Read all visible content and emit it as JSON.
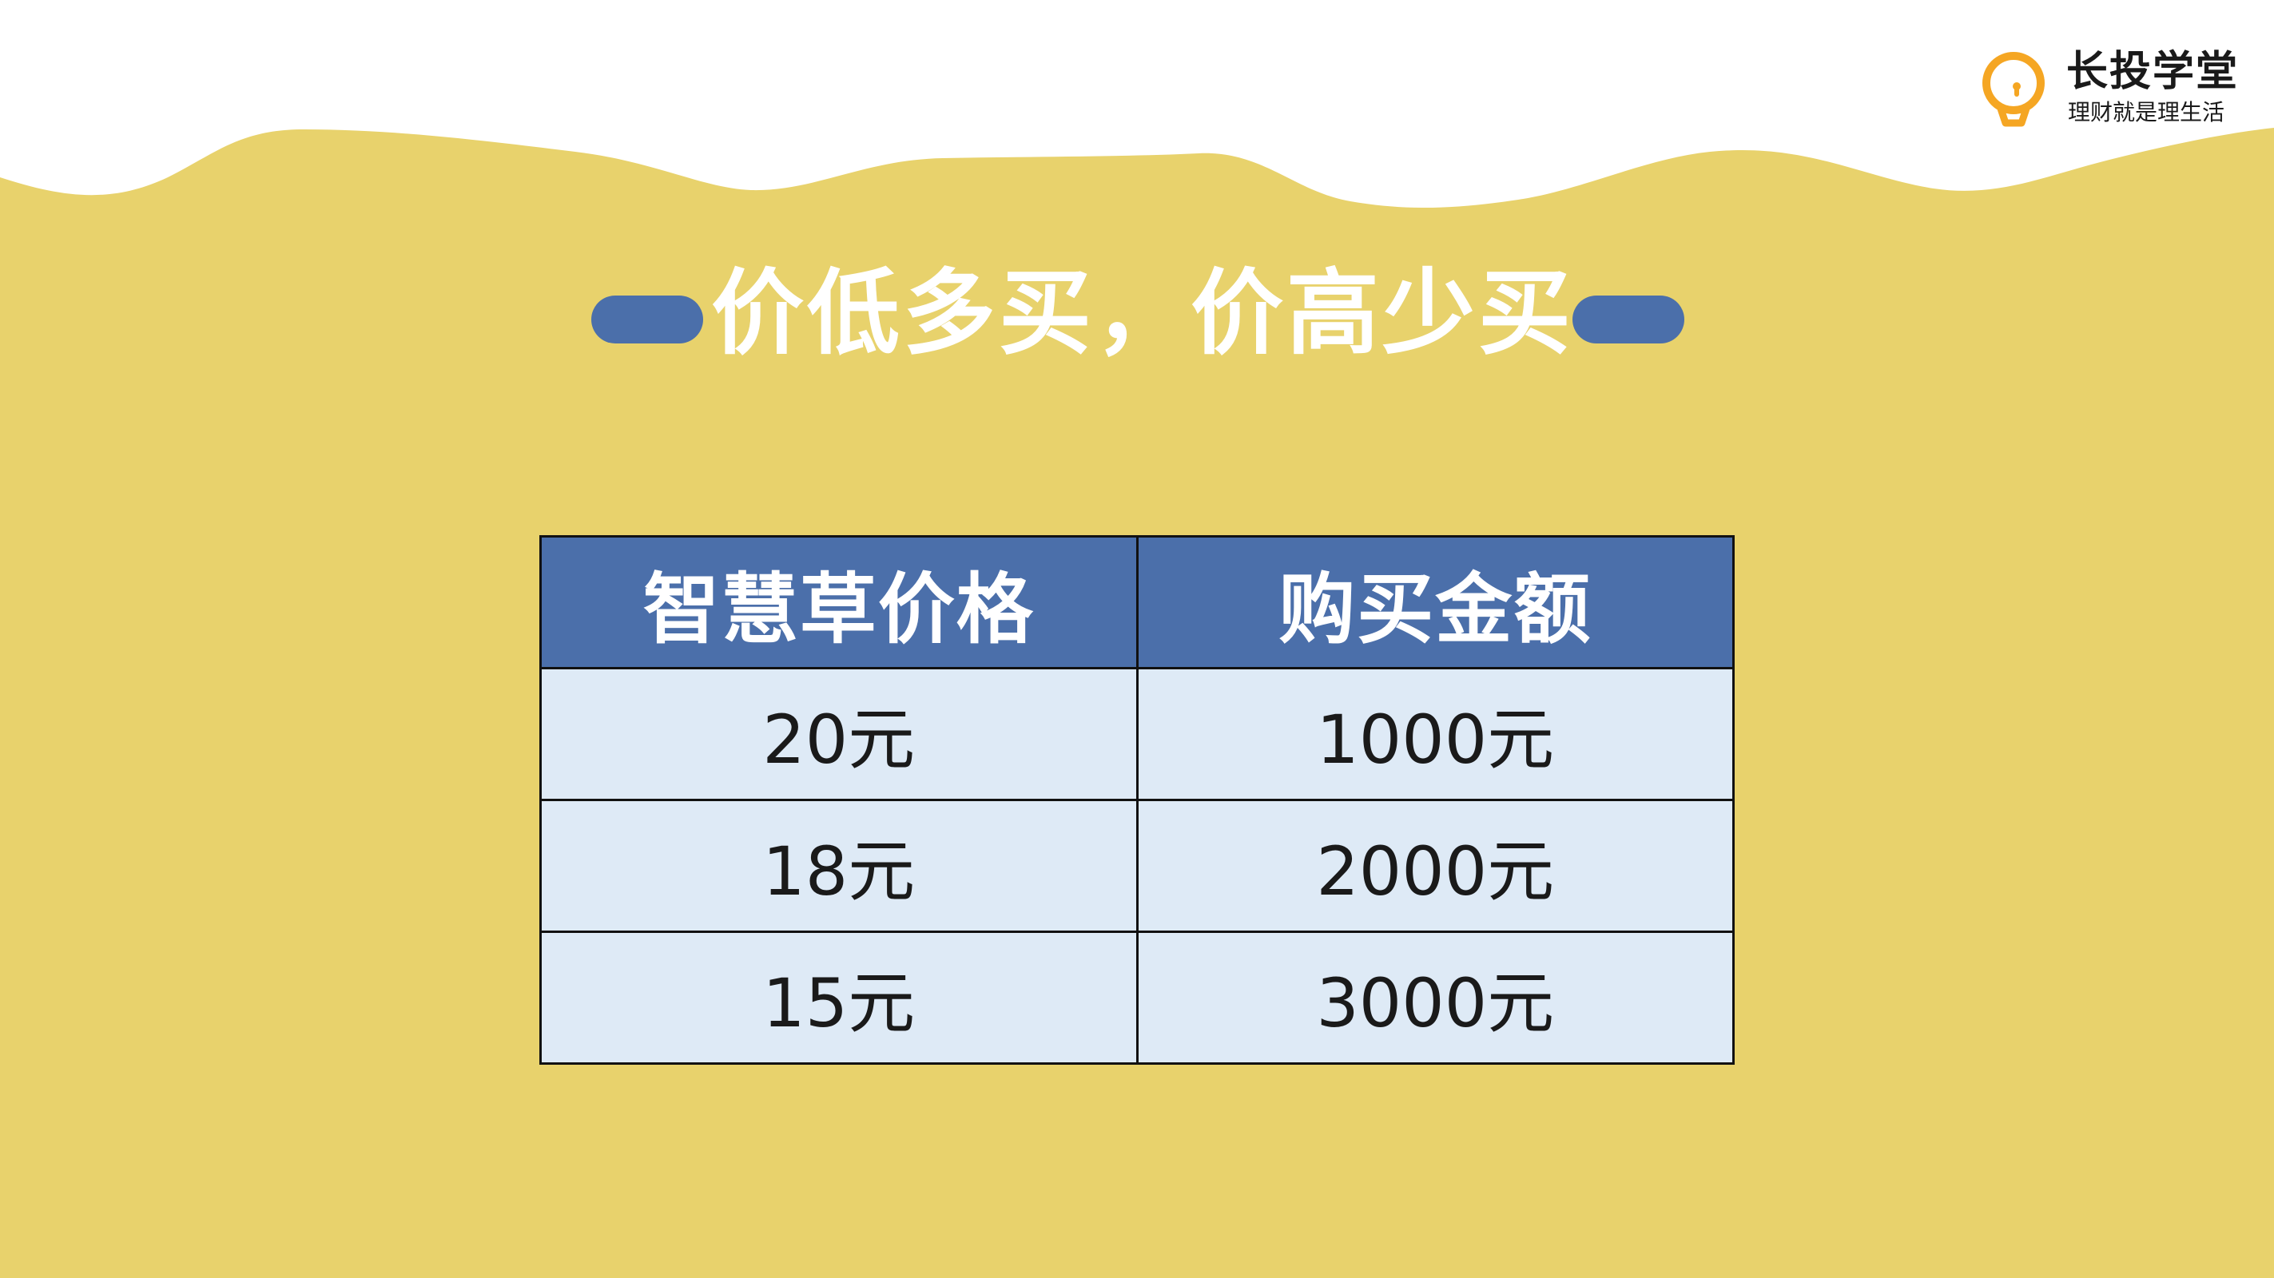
{
  "brand": {
    "name": "长投学堂",
    "slogan": "理财就是理生活",
    "icon": "lightbulb-icon",
    "accent_color": "#f5a623"
  },
  "colors": {
    "background": "#e8d26c",
    "header_fill": "#4b6faa",
    "cell_fill": "#deeaf6"
  },
  "slide": {
    "title": "价低多买，价高少买"
  },
  "table": {
    "headers": [
      "智慧草价格",
      "购买金额"
    ],
    "rows": [
      [
        "20元",
        "1000元"
      ],
      [
        "18元",
        "2000元"
      ],
      [
        "15元",
        "3000元"
      ]
    ]
  }
}
